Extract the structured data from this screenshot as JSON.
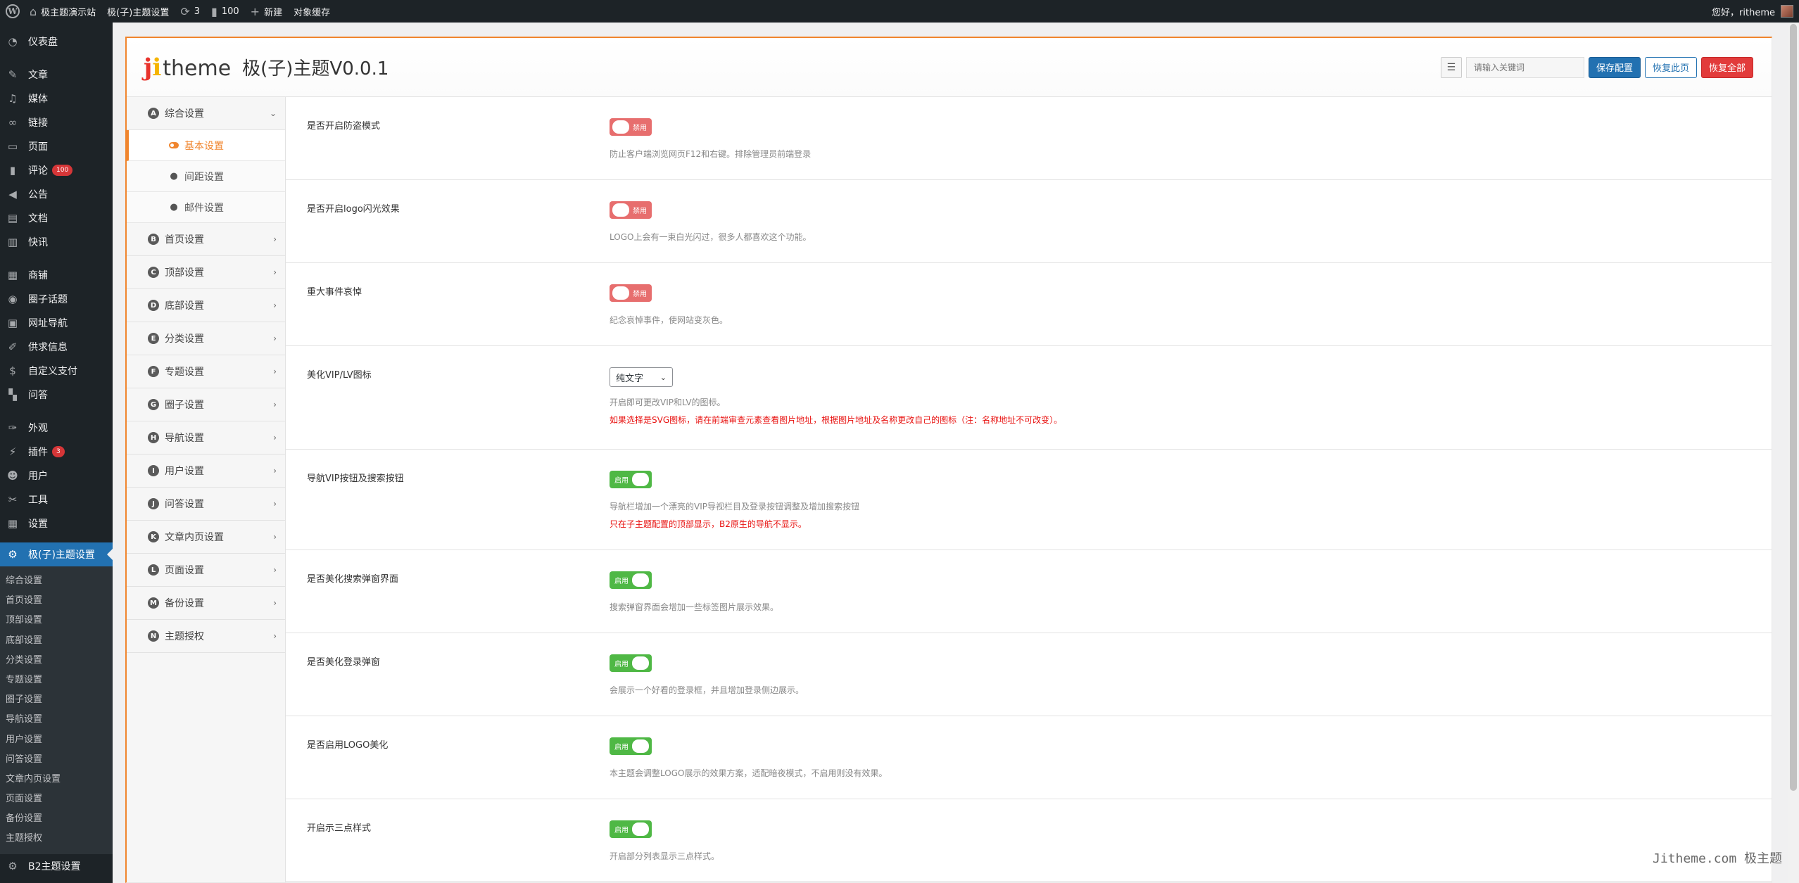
{
  "admin_bar": {
    "site_name": "极主题演示站",
    "theme_settings": "极(子)主题设置",
    "updates_count": "3",
    "comments_count": "100",
    "new_label": "新建",
    "cache_label": "对象缓存",
    "greeting": "您好，ritheme"
  },
  "admin_menu": {
    "items": [
      {
        "label": "仪表盘",
        "icon": "dashboard-icon"
      },
      {
        "label": "文章",
        "icon": "pin-icon"
      },
      {
        "label": "媒体",
        "icon": "media-icon"
      },
      {
        "label": "链接",
        "icon": "link-icon"
      },
      {
        "label": "页面",
        "icon": "page-icon"
      },
      {
        "label": "评论",
        "icon": "comment-icon",
        "badge": "100"
      },
      {
        "label": "公告",
        "icon": "megaphone-icon"
      },
      {
        "label": "文档",
        "icon": "document-icon"
      },
      {
        "label": "快讯",
        "icon": "flash-icon"
      },
      {
        "label": "商铺",
        "icon": "store-icon"
      },
      {
        "label": "圈子话题",
        "icon": "circle-icon"
      },
      {
        "label": "网址导航",
        "icon": "globe-icon"
      },
      {
        "label": "供求信息",
        "icon": "exchange-icon"
      },
      {
        "label": "自定义支付",
        "icon": "dollar-icon"
      },
      {
        "label": "问答",
        "icon": "qa-icon"
      },
      {
        "label": "外观",
        "icon": "brush-icon"
      },
      {
        "label": "插件",
        "icon": "plugin-icon",
        "badge": "3"
      },
      {
        "label": "用户",
        "icon": "user-icon"
      },
      {
        "label": "工具",
        "icon": "wrench-icon"
      },
      {
        "label": "设置",
        "icon": "settings-icon"
      },
      {
        "label": "极(子)主题设置",
        "icon": "gear-icon"
      },
      {
        "label": "B2主题设置",
        "icon": "gear-icon"
      }
    ],
    "submenu": [
      "综合设置",
      "首页设置",
      "顶部设置",
      "底部设置",
      "分类设置",
      "专题设置",
      "圈子设置",
      "导航设置",
      "用户设置",
      "问答设置",
      "文章内页设置",
      "页面设置",
      "备份设置",
      "主题授权"
    ]
  },
  "header": {
    "logo_j": "j",
    "logo_i": "i",
    "logo_rest": "theme",
    "title": "极(子)主题V0.0.1",
    "search_placeholder": "请输入关键词",
    "save_label": "保存配置",
    "restore_page_label": "恢复此页",
    "restore_all_label": "恢复全部"
  },
  "nav": {
    "general": {
      "letter": "A",
      "label": "综合设置"
    },
    "general_sub": [
      {
        "label": "基本设置",
        "active": true
      },
      {
        "label": "间距设置"
      },
      {
        "label": "邮件设置"
      }
    ],
    "sections": [
      {
        "letter": "B",
        "label": "首页设置"
      },
      {
        "letter": "C",
        "label": "顶部设置"
      },
      {
        "letter": "D",
        "label": "底部设置"
      },
      {
        "letter": "E",
        "label": "分类设置"
      },
      {
        "letter": "F",
        "label": "专题设置"
      },
      {
        "letter": "G",
        "label": "圈子设置"
      },
      {
        "letter": "H",
        "label": "导航设置"
      },
      {
        "letter": "I",
        "label": "用户设置"
      },
      {
        "letter": "J",
        "label": "问答设置"
      },
      {
        "letter": "K",
        "label": "文章内页设置"
      },
      {
        "letter": "L",
        "label": "页面设置"
      },
      {
        "letter": "M",
        "label": "备份设置"
      },
      {
        "letter": "N",
        "label": "主题授权"
      }
    ]
  },
  "switch_labels": {
    "on": "启用",
    "off": "禁用"
  },
  "options": [
    {
      "label": "是否开启防盗模式",
      "state": "off",
      "desc": "防止客户端浏览网页F12和右键。排除管理员前端登录"
    },
    {
      "label": "是否开启logo闪光效果",
      "state": "off",
      "desc": "LOGO上会有一束白光闪过，很多人都喜欢这个功能。"
    },
    {
      "label": "重大事件哀悼",
      "state": "off",
      "desc": "纪念哀悼事件，使网站变灰色。"
    },
    {
      "label": "美化VIP/LV图标",
      "select": "纯文字",
      "desc": "开启即可更改VIP和LV的图标。",
      "warn": "如果选择是SVG图标，请在前端审查元素查看图片地址，根据图片地址及名称更改自己的图标（注：名称地址不可改变）。"
    },
    {
      "label": "导航VIP按钮及搜索按钮",
      "state": "on",
      "desc": "导航栏增加一个漂亮的VIP导视栏目及登录按钮调整及增加搜索按钮",
      "warn": "只在子主题配置的顶部显示，B2原生的导航不显示。"
    },
    {
      "label": "是否美化搜索弹窗界面",
      "state": "on",
      "desc": "搜索弹窗界面会增加一些标签图片展示效果。"
    },
    {
      "label": "是否美化登录弹窗",
      "state": "on",
      "desc": "会展示一个好看的登录框，并且增加登录侧边展示。"
    },
    {
      "label": "是否启用LOGO美化",
      "state": "on",
      "desc": "本主题会调整LOGO展示的效果方案，适配暗夜模式，不启用则没有效果。"
    },
    {
      "label": "开启示三点样式",
      "state": "on",
      "desc": "开启部分列表显示三点样式。"
    }
  ],
  "watermark": "Jitheme.com 极主题"
}
